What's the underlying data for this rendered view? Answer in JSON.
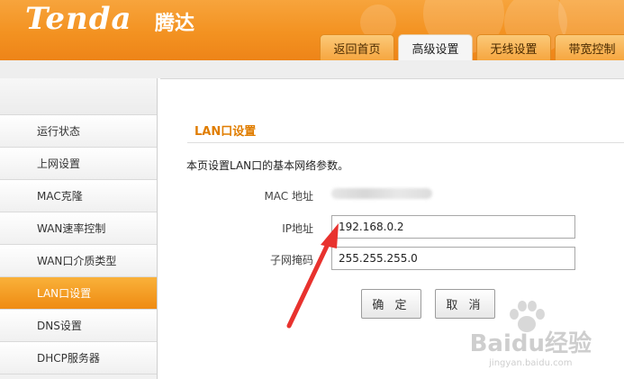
{
  "header": {
    "logo_text": "Tenda",
    "logo_cn": "腾达",
    "tabs": [
      {
        "label": "返回首页",
        "active": false
      },
      {
        "label": "高级设置",
        "active": true
      },
      {
        "label": "无线设置",
        "active": false
      },
      {
        "label": "带宽控制",
        "active": false
      }
    ]
  },
  "sidebar": {
    "items": [
      {
        "label": "运行状态",
        "active": false
      },
      {
        "label": "上网设置",
        "active": false
      },
      {
        "label": "MAC克隆",
        "active": false
      },
      {
        "label": "WAN速率控制",
        "active": false
      },
      {
        "label": "WAN口介质类型",
        "active": false
      },
      {
        "label": "LAN口设置",
        "active": true
      },
      {
        "label": "DNS设置",
        "active": false
      },
      {
        "label": "DHCP服务器",
        "active": false
      }
    ]
  },
  "main": {
    "title": "LAN口设置",
    "description": "本页设置LAN口的基本网络参数。",
    "mac_label": "MAC 地址",
    "ip_label": "IP地址",
    "ip_value": "192.168.0.2",
    "mask_label": "子网掩码",
    "mask_value": "255.255.255.0",
    "confirm_label": "确 定",
    "cancel_label": "取 消"
  },
  "watermark": {
    "main": "Baidu经验",
    "sub": "jingyan.baidu.com"
  },
  "colors": {
    "brand_orange": "#f39221",
    "title_orange": "#e07d00",
    "active_item": "#ef8b12",
    "annotation_arrow": "#e8322e"
  }
}
